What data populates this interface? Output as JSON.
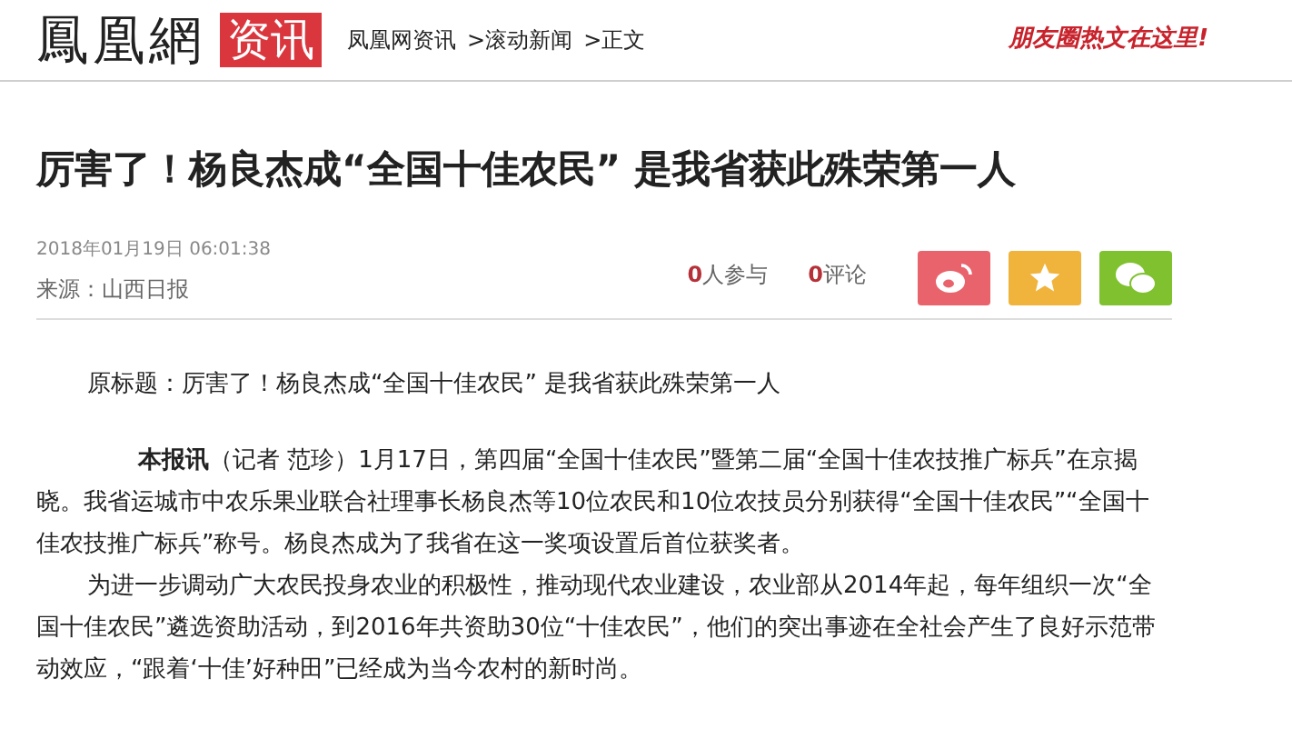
{
  "header": {
    "logo": "鳳凰網",
    "channel": "资讯",
    "breadcrumb": [
      "凤凰网资讯",
      ">滚动新闻",
      ">正文"
    ],
    "promo": "朋友圈热文在这里!"
  },
  "article": {
    "title": "厉害了！杨良杰成“全国十佳农民” 是我省获此殊荣第一人",
    "datetime": "2018年01月19日  06:01:38",
    "source": "来源：山西日报",
    "stats": [
      {
        "count": "0",
        "label": "人参与"
      },
      {
        "count": "0",
        "label": "评论"
      }
    ],
    "share": [
      {
        "kind": "weibo"
      },
      {
        "kind": "favorite"
      },
      {
        "kind": "wechat"
      }
    ],
    "original_title": "原标题：厉害了！杨良杰成“全国十佳农民”  是我省获此殊荣第一人",
    "paragraphs": [
      "**本报讯**（记者  范珍）1月17日，第四届“全国十佳农民”暨第二届“全国十佳农技推广标兵”在京揭晓。我省运城市中农乐果业联合社理事长杨良杰等10位农民和10位农技员分别获得“全国十佳农民”“全国十佳农技推广标兵”称号。杨良杰成为了我省在这一奖项设置后首位获奖者。",
      "为进一步调动广大农民投身农业的积极性，推动现代农业建设，农业部从2014年起，每年组织一次“全国十佳农民”遴选资助活动，到2016年共资助30位“十佳农民”，他们的突出事迹在全社会产生了良好示范带动效应，“跟着‘十佳’好种田”已经成为当今农村的新时尚。"
    ]
  }
}
